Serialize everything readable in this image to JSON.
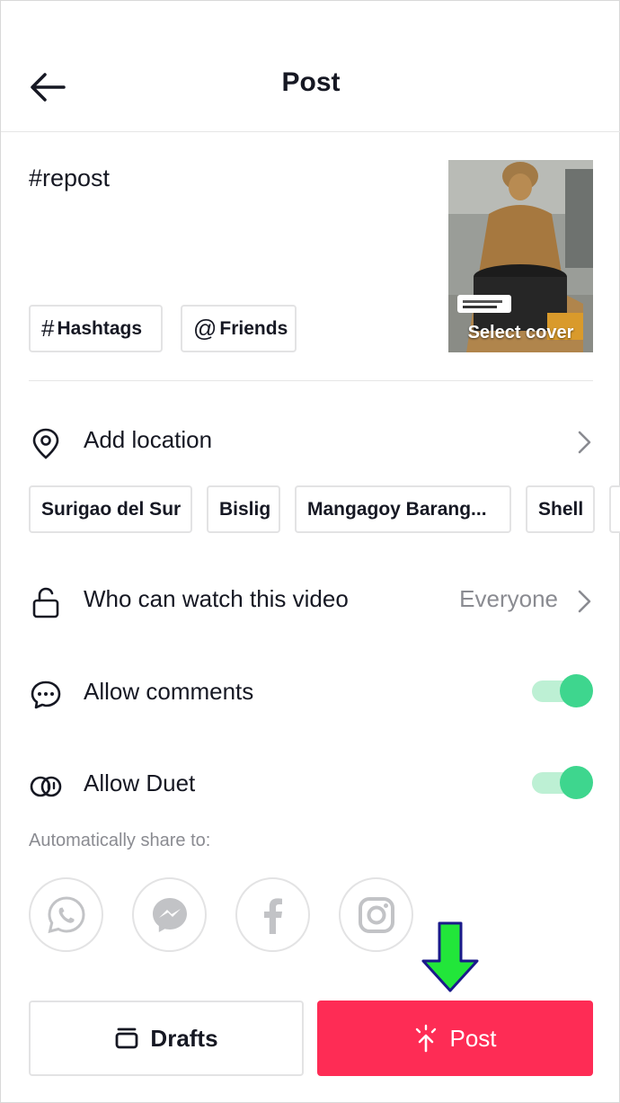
{
  "header": {
    "title": "Post"
  },
  "caption": "#repost",
  "tags": {
    "hashtags_symbol": "#",
    "hashtags_label": "Hashtags",
    "friends_symbol": "@",
    "friends_label": "Friends"
  },
  "cover": {
    "label": "Select cover"
  },
  "location": {
    "label": "Add location",
    "suggestions": [
      "Surigao del Sur",
      "Bislig",
      "Mangagoy Barang...",
      "Shell"
    ]
  },
  "privacy": {
    "label": "Who can watch this video",
    "value": "Everyone"
  },
  "comments": {
    "label": "Allow comments",
    "enabled": true
  },
  "duet": {
    "label": "Allow Duet",
    "enabled": true
  },
  "share": {
    "label": "Automatically share to:",
    "targets": [
      "whatsapp-icon",
      "messenger-icon",
      "facebook-icon",
      "instagram-icon"
    ]
  },
  "footer": {
    "drafts_label": "Drafts",
    "post_label": "Post"
  },
  "colors": {
    "accent": "#fe2c55",
    "toggle_on": "#3ed68e",
    "toggle_track": "#bdf0d4",
    "pointer": "#22e63a"
  }
}
